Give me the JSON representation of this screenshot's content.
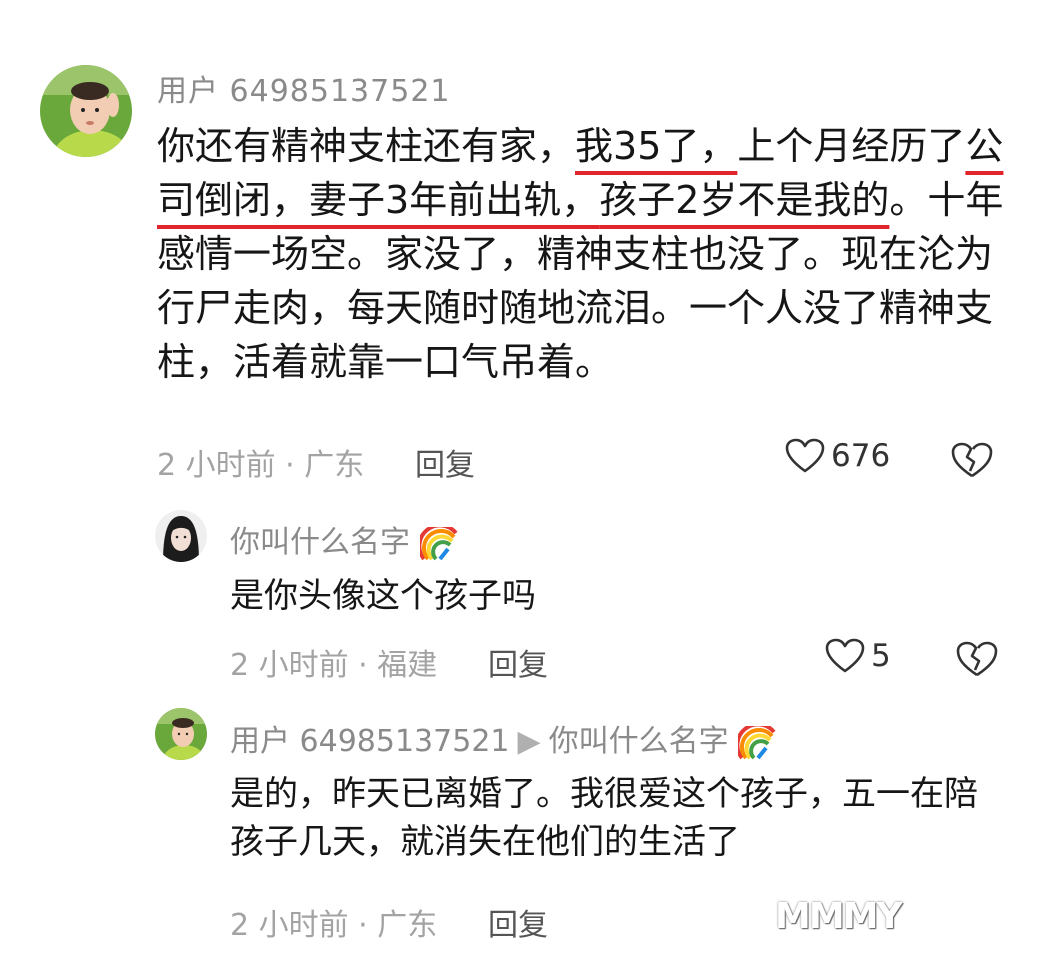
{
  "comments": [
    {
      "username": "用户 64985137521",
      "text_segments": [
        {
          "text": "你还有精神支柱还有家，",
          "underline": false
        },
        {
          "text": "我35了，",
          "underline": true
        },
        {
          "text": "上个月经历了",
          "underline": false
        },
        {
          "text": "公司倒闭，",
          "underline": true
        },
        {
          "text": "妻子3年前出轨，",
          "underline": true
        },
        {
          "text": "孩子2岁不是我的",
          "underline": true
        },
        {
          "text": "。十年感情一场空。家没了，精神支柱也没了。现在沦为行尸走肉，每天随时随地流泪。一个人没了精神支柱，活着就靠一口气吊着。",
          "underline": false
        }
      ],
      "meta": "2 小时前 · 广东",
      "reply_label": "回复",
      "likes": "676",
      "like_icon": "heart-outline-icon",
      "dislike_icon": "broken-heart-icon"
    },
    {
      "username": "你叫什么名字",
      "username_emoji": "rainbow-emoji",
      "text": "是你头像这个孩子吗",
      "meta": "2 小时前 · 福建",
      "reply_label": "回复",
      "likes": "5",
      "like_icon": "heart-outline-icon",
      "dislike_icon": "broken-heart-icon"
    },
    {
      "username": "用户 64985137521",
      "reply_arrow": "▶",
      "reply_to": "你叫什么名字",
      "reply_to_emoji": "rainbow-emoji",
      "text": "是的，昨天已离婚了。我很爱这个孩子，五一在陪孩子几天，就消失在他们的生活了",
      "meta": "2 小时前 · 广东",
      "reply_label": "回复"
    }
  ],
  "watermark": "MMMY",
  "colors": {
    "underline": "#e0242b",
    "username": "#8a8a8a",
    "meta": "#a3a3a3",
    "text": "#161616"
  }
}
